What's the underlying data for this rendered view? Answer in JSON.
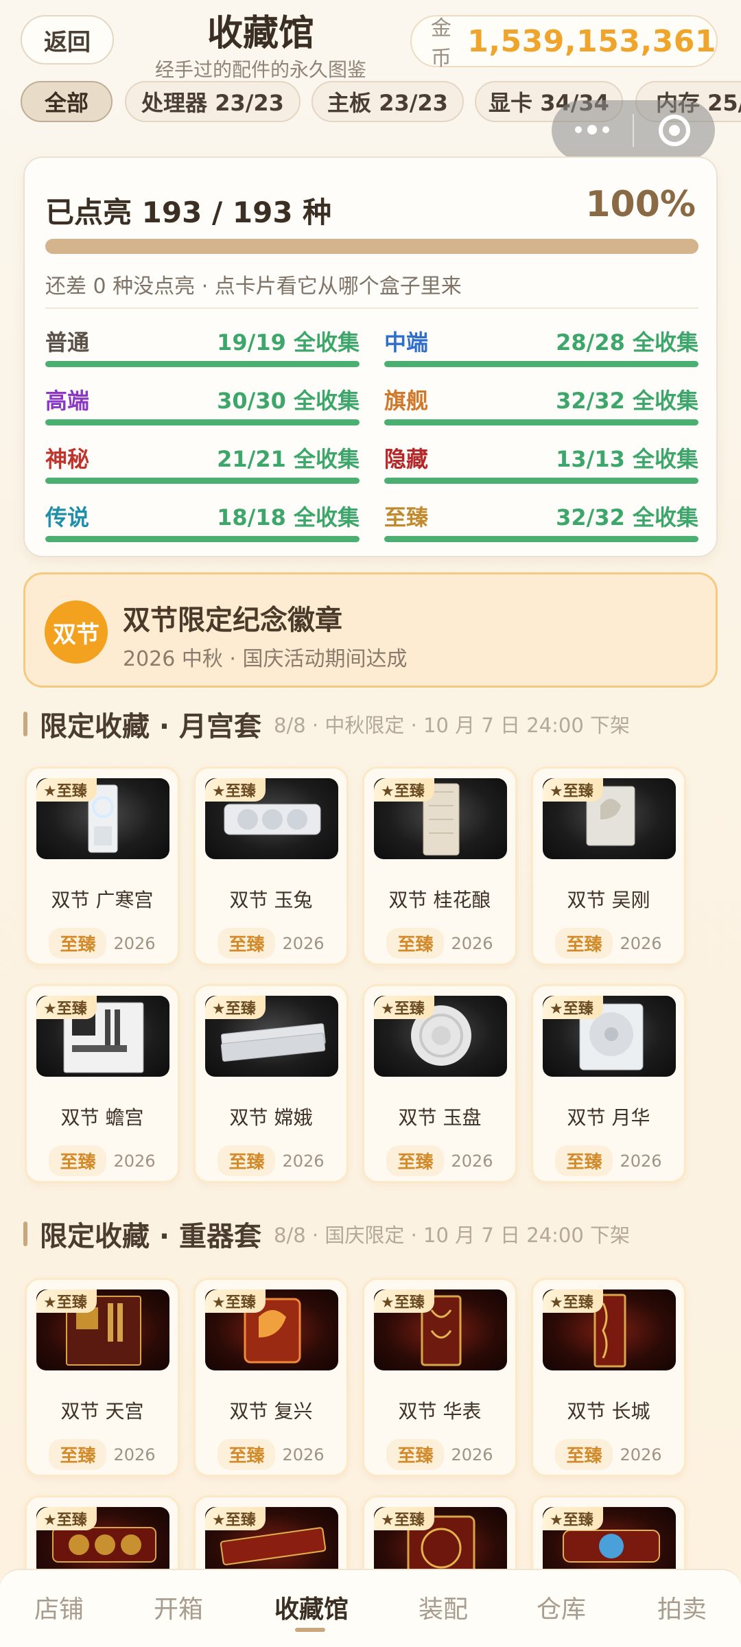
{
  "header": {
    "back_label": "返回",
    "title": "收藏馆",
    "subtitle": "经手过的配件的永久图鉴",
    "coins_label": "金币",
    "coins_value": "1,539,153,361"
  },
  "filters": [
    {
      "label": "全部",
      "active": true
    },
    {
      "label": "处理器 23/23",
      "active": false
    },
    {
      "label": "主板 23/23",
      "active": false
    },
    {
      "label": "显卡 34/34",
      "active": false
    },
    {
      "label": "内存 25/",
      "active": false
    }
  ],
  "progress": {
    "lit_text": "已点亮 193 / 193 种",
    "percent_text": "100%",
    "percent": 100,
    "hint": "还差 0 种没点亮 · 点卡片看它从哪个盒子里来",
    "rarities": [
      {
        "name": "普通",
        "count": "19/19 全收集",
        "color": "#5b5148"
      },
      {
        "name": "中端",
        "count": "28/28 全收集",
        "color": "#2f6fc9"
      },
      {
        "name": "高端",
        "count": "30/30 全收集",
        "color": "#8a37c4"
      },
      {
        "name": "旗舰",
        "count": "32/32 全收集",
        "color": "#d2782a"
      },
      {
        "name": "神秘",
        "count": "21/21 全收集",
        "color": "#c0342e"
      },
      {
        "name": "隐藏",
        "count": "13/13 全收集",
        "color": "#b3292a"
      },
      {
        "name": "传说",
        "count": "18/18 全收集",
        "color": "#1e8fa8"
      },
      {
        "name": "至臻",
        "count": "32/32 全收集",
        "color": "#c08a2e"
      }
    ]
  },
  "badge": {
    "icon_text": "双节",
    "title": "双节限定纪念徽章",
    "subtitle": "2026 中秋 · 国庆活动期间达成"
  },
  "sections": [
    {
      "title": "限定收藏 · 月宫套",
      "meta": "8/8 · 中秋限定 · 10 月 7 日 24:00 下架",
      "items": [
        {
          "tag": "★至臻",
          "name": "双节 广寒宫",
          "rarity": "至臻",
          "year": "2026",
          "icon": "white-pc-case-icon"
        },
        {
          "tag": "★至臻",
          "name": "双节 玉兔",
          "rarity": "至臻",
          "year": "2026",
          "icon": "white-graphics-card-icon"
        },
        {
          "tag": "★至臻",
          "name": "双节 桂花酿",
          "rarity": "至臻",
          "year": "2026",
          "icon": "white-cpu-cooler-icon"
        },
        {
          "tag": "★至臻",
          "name": "双节 吴刚",
          "rarity": "至臻",
          "year": "2026",
          "icon": "white-cpu-chip-icon"
        },
        {
          "tag": "★至臻",
          "name": "双节 蟾宫",
          "rarity": "至臻",
          "year": "2026",
          "icon": "white-motherboard-icon"
        },
        {
          "tag": "★至臻",
          "name": "双节 嫦娥",
          "rarity": "至臻",
          "year": "2026",
          "icon": "white-ram-stick-icon"
        },
        {
          "tag": "★至臻",
          "name": "双节 玉盘",
          "rarity": "至臻",
          "year": "2026",
          "icon": "white-fan-icon"
        },
        {
          "tag": "★至臻",
          "name": "双节 月华",
          "rarity": "至臻",
          "year": "2026",
          "icon": "white-power-supply-icon"
        }
      ]
    },
    {
      "title": "限定收藏 · 重器套",
      "meta": "8/8 · 国庆限定 · 10 月 7 日 24:00 下架",
      "items": [
        {
          "tag": "★至臻",
          "name": "双节 天宫",
          "rarity": "至臻",
          "year": "2026",
          "icon": "red-gold-motherboard-icon"
        },
        {
          "tag": "★至臻",
          "name": "双节 复兴",
          "rarity": "至臻",
          "year": "2026",
          "icon": "dragon-cpu-chip-icon"
        },
        {
          "tag": "★至臻",
          "name": "双节 华表",
          "rarity": "至臻",
          "year": "2026",
          "icon": "red-gold-case-icon"
        },
        {
          "tag": "★至臻",
          "name": "双节 长城",
          "rarity": "至臻",
          "year": "2026",
          "icon": "red-gold-tower-icon"
        },
        {
          "tag": "★至臻",
          "name": "",
          "rarity": "",
          "year": "",
          "icon": "red-graphics-card-icon"
        },
        {
          "tag": "★至臻",
          "name": "",
          "rarity": "",
          "year": "",
          "icon": "red-ram-stick-icon"
        },
        {
          "tag": "★至臻",
          "name": "",
          "rarity": "",
          "year": "",
          "icon": "red-power-supply-icon"
        },
        {
          "tag": "★至臻",
          "name": "",
          "rarity": "",
          "year": "",
          "icon": "red-gold-gpu-icon"
        }
      ]
    }
  ],
  "bottom_nav": [
    {
      "label": "店铺",
      "active": false
    },
    {
      "label": "开箱",
      "active": false
    },
    {
      "label": "收藏馆",
      "active": true
    },
    {
      "label": "装配",
      "active": false
    },
    {
      "label": "仓库",
      "active": false
    },
    {
      "label": "拍卖",
      "active": false
    }
  ]
}
